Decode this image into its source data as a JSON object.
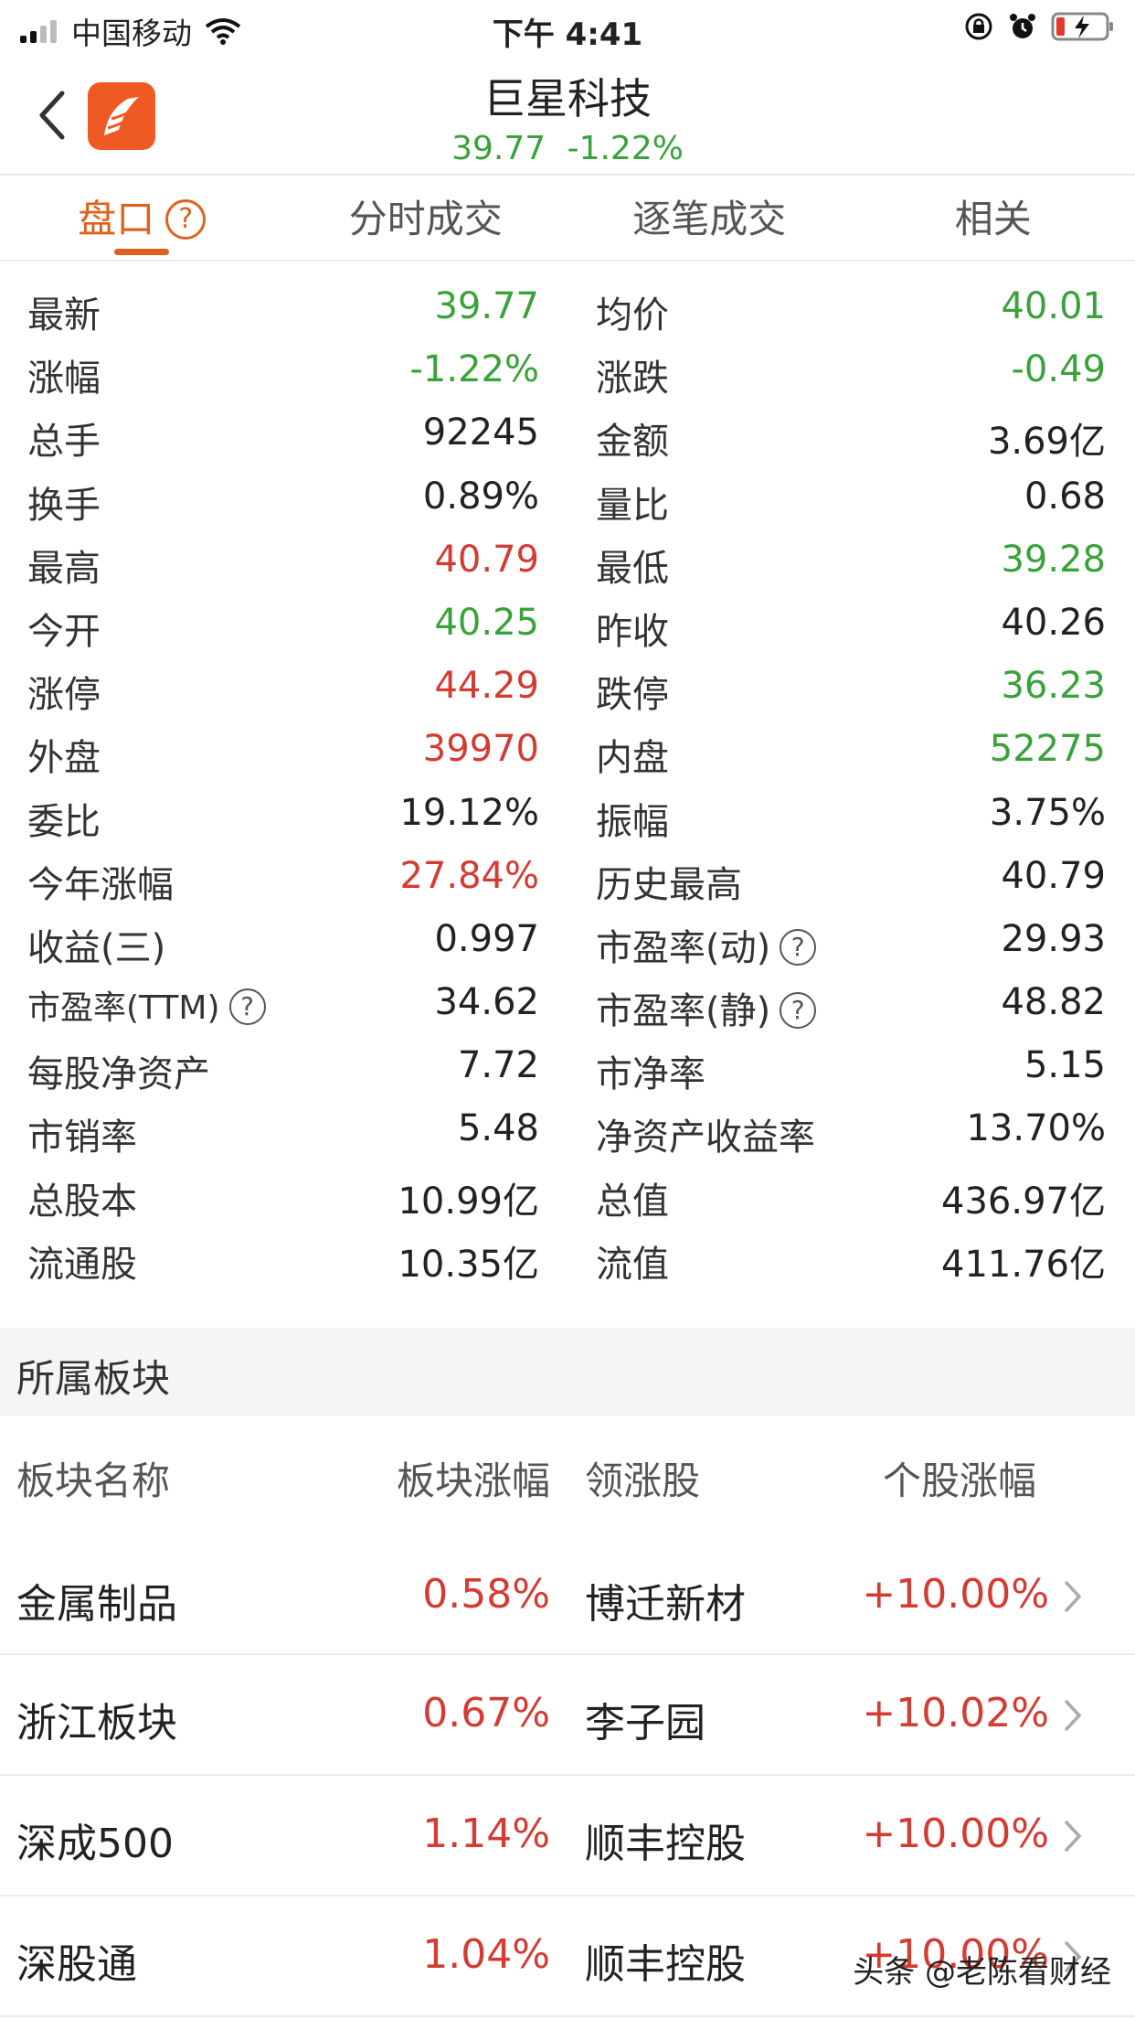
{
  "status_bar": {
    "carrier": "中国移动",
    "time": "下午 4:41"
  },
  "header": {
    "stock_name": "巨星科技",
    "price": "39.77",
    "change_pct": "-1.22%"
  },
  "tabs": [
    {
      "label": "盘口",
      "help": "?"
    },
    {
      "label": "分时成交"
    },
    {
      "label": "逐笔成交"
    },
    {
      "label": "相关"
    }
  ],
  "stats": [
    {
      "l_label": "最新",
      "l_value": "39.77",
      "r_label": "均价",
      "r_value": "40.01"
    },
    {
      "l_label": "涨幅",
      "l_value": "-1.22%",
      "r_label": "涨跌",
      "r_value": "-0.49"
    },
    {
      "l_label": "总手",
      "l_value": "92245",
      "r_label": "金额",
      "r_value": "3.69亿"
    },
    {
      "l_label": "换手",
      "l_value": "0.89%",
      "r_label": "量比",
      "r_value": "0.68"
    },
    {
      "l_label": "最高",
      "l_value": "40.79",
      "r_label": "最低",
      "r_value": "39.28"
    },
    {
      "l_label": "今开",
      "l_value": "40.25",
      "r_label": "昨收",
      "r_value": "40.26"
    },
    {
      "l_label": "涨停",
      "l_value": "44.29",
      "r_label": "跌停",
      "r_value": "36.23"
    },
    {
      "l_label": "外盘",
      "l_value": "39970",
      "r_label": "内盘",
      "r_value": "52275"
    },
    {
      "l_label": "委比",
      "l_value": "19.12%",
      "r_label": "振幅",
      "r_value": "3.75%"
    },
    {
      "l_label": "今年涨幅",
      "l_value": "27.84%",
      "r_label": "历史最高",
      "r_value": "40.79"
    },
    {
      "l_label": "收益(三)",
      "l_value": "0.997",
      "r_label": "市盈率(动)",
      "r_value": "29.93"
    },
    {
      "l_label": "市盈率(TTM)",
      "l_value": "34.62",
      "r_label": "市盈率(静)",
      "r_value": "48.82"
    },
    {
      "l_label": "每股净资产",
      "l_value": "7.72",
      "r_label": "市净率",
      "r_value": "5.15"
    },
    {
      "l_label": "市销率",
      "l_value": "5.48",
      "r_label": "净资产收益率",
      "r_value": "13.70%"
    },
    {
      "l_label": "总股本",
      "l_value": "10.99亿",
      "r_label": "总值",
      "r_value": "436.97亿"
    },
    {
      "l_label": "流通股",
      "l_value": "10.35亿",
      "r_label": "流值",
      "r_value": "411.76亿"
    }
  ],
  "help_mark": "?",
  "sector": {
    "title": "所属板块",
    "columns": [
      "板块名称",
      "板块涨幅",
      "领涨股",
      "个股涨幅"
    ],
    "rows": [
      {
        "name": "金属制品",
        "change": "0.58%",
        "leader": "博迁新材",
        "leader_change": "+10.00%"
      },
      {
        "name": "浙江板块",
        "change": "0.67%",
        "leader": "李子园",
        "leader_change": "+10.02%"
      },
      {
        "name": "深成500",
        "change": "1.14%",
        "leader": "顺丰控股",
        "leader_change": "+10.00%"
      },
      {
        "name": "深股通",
        "change": "1.04%",
        "leader": "顺丰控股",
        "leader_change": "+10.00%"
      }
    ]
  },
  "watermark": "头条 @老陈看财经",
  "colors": {
    "up": "#d43b32",
    "down": "#3aa23a",
    "accent": "#e0611e",
    "brand": "#ef5a24"
  }
}
